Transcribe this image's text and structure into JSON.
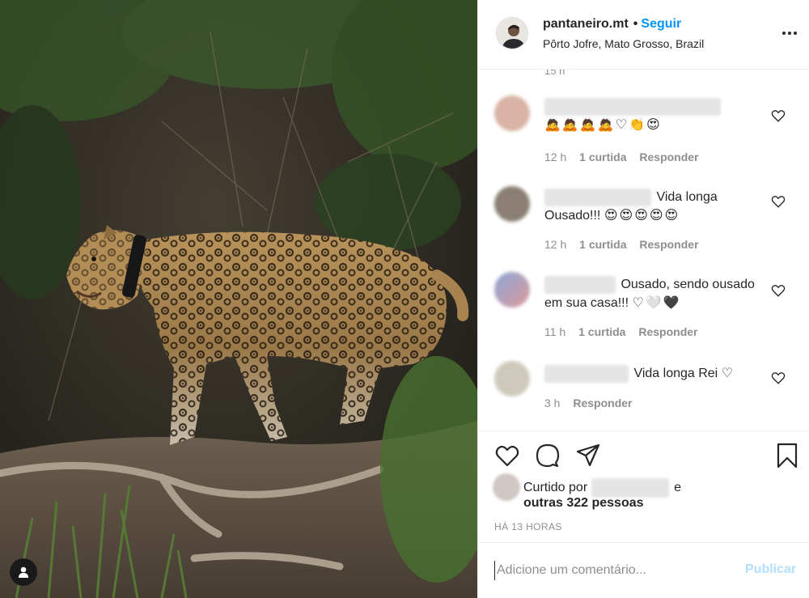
{
  "post": {
    "username": "pantaneiro.mt",
    "separator": "•",
    "follow_label": "Seguir",
    "location": "Pôrto Jofre, Mato Grosso, Brazil",
    "more_icon": "more-dots-icon"
  },
  "comments": {
    "cut_timestamp": "15 h",
    "items": [
      {
        "text": "",
        "emoji": "🙇🙇🙇🙇♡👏😍",
        "time": "12 h",
        "likes": "1 curtida",
        "reply": "Responder"
      },
      {
        "text": "Vida longa Ousado!!!",
        "emoji": "😍😍😍😍😍",
        "time": "12 h",
        "likes": "1 curtida",
        "reply": "Responder"
      },
      {
        "text": "Ousado, sendo ousado em sua casa!!!",
        "emoji": "♡🤍🖤",
        "time": "11 h",
        "likes": "1 curtida",
        "reply": "Responder"
      },
      {
        "text": "Vida longa Rei",
        "emoji": "♡",
        "time": "3 h",
        "likes": "",
        "reply": "Responder"
      }
    ]
  },
  "actions": {
    "like_icon": "heart-icon",
    "comment_icon": "comment-bubble-icon",
    "share_icon": "paper-plane-icon",
    "save_icon": "bookmark-icon",
    "liked_by_prefix": "Curtido por",
    "liked_by_suffix": "e",
    "liked_by_others": "outras 322 pessoas",
    "posted_time": "HÁ 13 HORAS"
  },
  "compose": {
    "placeholder": "Adicione um comentário...",
    "publish_label": "Publicar"
  },
  "colors": {
    "link_blue": "#0095f6",
    "publish_disabled": "#b2dffc",
    "secondary_text": "#8e8e8e",
    "primary_text": "#262626"
  }
}
